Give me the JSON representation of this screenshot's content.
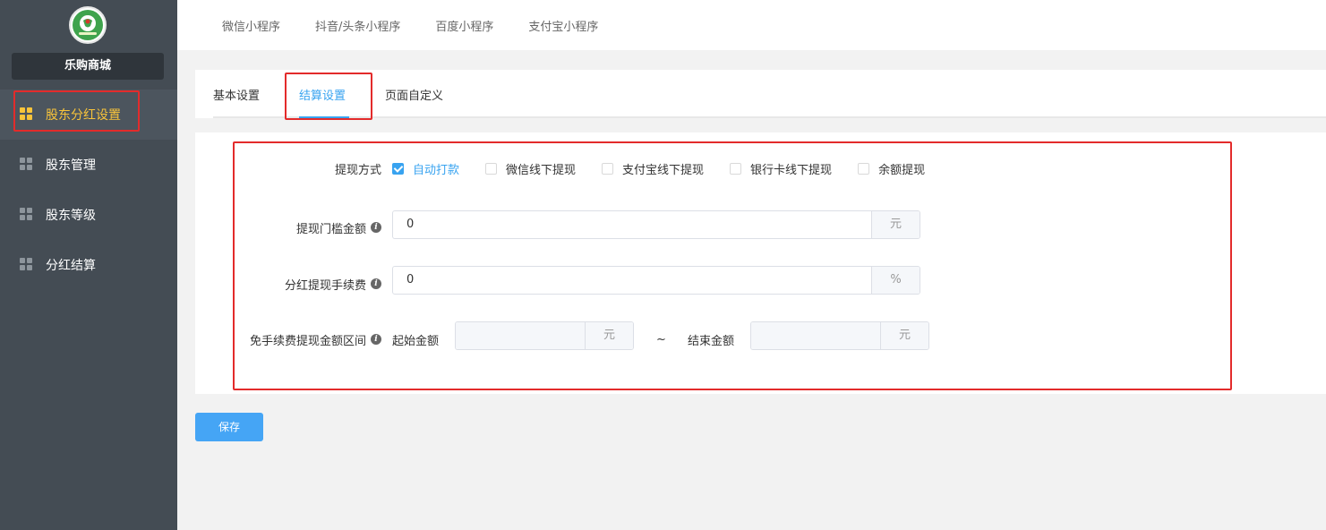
{
  "sidebar": {
    "store_name": "乐购商城",
    "items": [
      {
        "label": "股东分红设置",
        "active": true
      },
      {
        "label": "股东管理",
        "active": false
      },
      {
        "label": "股东等级",
        "active": false
      },
      {
        "label": "分红结算",
        "active": false
      }
    ]
  },
  "topbar": {
    "tabs": [
      "微信小程序",
      "抖音/头条小程序",
      "百度小程序",
      "支付宝小程序"
    ]
  },
  "subtabs": {
    "items": [
      "基本设置",
      "结算设置",
      "页面自定义"
    ],
    "active_index": 1
  },
  "form": {
    "withdraw_method": {
      "label": "提现方式",
      "options": [
        {
          "label": "自动打款",
          "checked": true
        },
        {
          "label": "微信线下提现",
          "checked": false
        },
        {
          "label": "支付宝线下提现",
          "checked": false
        },
        {
          "label": "银行卡线下提现",
          "checked": false
        },
        {
          "label": "余额提现",
          "checked": false
        }
      ]
    },
    "threshold": {
      "label": "提现门槛金额",
      "value": "0",
      "suffix": "元"
    },
    "fee": {
      "label": "分红提现手续费",
      "value": "0",
      "suffix": "%"
    },
    "free_range": {
      "label": "免手续费提现金额区间",
      "start_label": "起始金额",
      "start_value": "",
      "start_suffix": "元",
      "separator": "~",
      "end_label": "结束金额",
      "end_value": "",
      "end_suffix": "元"
    }
  },
  "save_label": "保存",
  "colors": {
    "accent": "#38a3f0",
    "sidebar_bg": "#444c54",
    "active_nav": "#f9c43a",
    "annotation_red": "#e32b2b"
  }
}
